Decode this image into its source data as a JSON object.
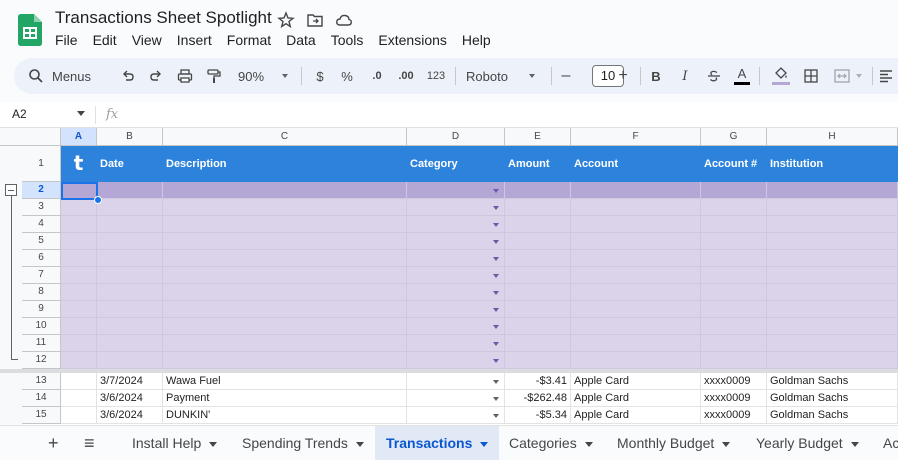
{
  "title": "Transactions Sheet Spotlight",
  "menu": [
    "File",
    "Edit",
    "View",
    "Insert",
    "Format",
    "Data",
    "Tools",
    "Extensions",
    "Help"
  ],
  "toolbar": {
    "menus_label": "Menus",
    "zoom": "90%",
    "currency": "$",
    "percent": "%",
    "dec_decrease": ".0",
    "dec_increase": ".00",
    "format_123": "123",
    "font": "Roboto",
    "font_size": "10",
    "font_color_letter": "A",
    "bold": "B",
    "italic": "I"
  },
  "namebox": "A2",
  "fx": "fx",
  "columns": [
    "A",
    "B",
    "C",
    "D",
    "E",
    "F",
    "G",
    "H"
  ],
  "header_row": {
    "logo": "t",
    "date": "Date",
    "description": "Description",
    "category": "Category",
    "amount": "Amount",
    "account": "Account",
    "account_num": "Account #",
    "institution": "Institution"
  },
  "row_numbers": [
    "1",
    "2",
    "3",
    "4",
    "5",
    "6",
    "7",
    "8",
    "9",
    "10",
    "11",
    "12",
    "13",
    "14",
    "15"
  ],
  "transactions": [
    {
      "row": "13",
      "date": "3/7/2024",
      "description": "Wawa Fuel",
      "amount": "-$3.41",
      "account": "Apple Card",
      "account_num": "xxxx0009",
      "institution": "Goldman Sachs"
    },
    {
      "row": "14",
      "date": "3/6/2024",
      "description": "Payment",
      "amount": "-$262.48",
      "account": "Apple Card",
      "account_num": "xxxx0009",
      "institution": "Goldman Sachs"
    },
    {
      "row": "15",
      "date": "3/6/2024",
      "description": "DUNKIN'",
      "amount": "-$5.34",
      "account": "Apple Card",
      "account_num": "xxxx0009",
      "institution": "Goldman Sachs"
    }
  ],
  "tabs": {
    "add": "+",
    "list": "≡",
    "install": "Install Help",
    "spending": "Spending Trends",
    "transactions": "Transactions",
    "categories": "Categories",
    "monthly": "Monthly Budget",
    "yearly": "Yearly Budget",
    "more": "Ac"
  },
  "colors": {
    "header_blue": "#2d83dc",
    "selected_row": "#b4a7d6",
    "row_purple": "#dad3e9",
    "active_tab": "#0b57d0"
  }
}
